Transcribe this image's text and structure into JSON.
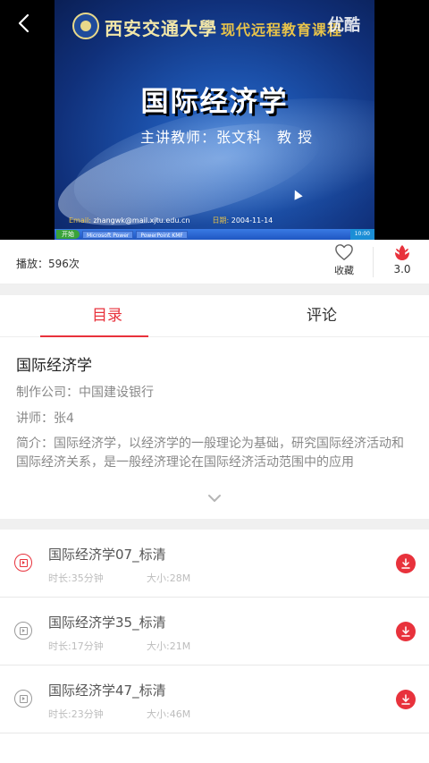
{
  "player": {
    "university": "西安交通大學",
    "program": "现代远程教育课程",
    "watermark": "优酷",
    "course_title": "国际经济学",
    "teacher_line": "主讲教师：张文科　教 授",
    "email_label": "Email:",
    "email": "zhangwk@mail.xjtu.edu.cn",
    "date_label": "日期:",
    "date": "2004-11-14",
    "taskbar": {
      "start": "开始",
      "items": [
        "Microsoft Power",
        "PowerPoint KMF"
      ],
      "clock": "10:00"
    }
  },
  "stats": {
    "plays": "播放：596次",
    "favorite_label": "收藏",
    "rating": "3.0"
  },
  "tabs": [
    {
      "label": "目录",
      "active": true
    },
    {
      "label": "评论",
      "active": false
    }
  ],
  "course": {
    "title": "国际经济学",
    "company_label": "制作公司：",
    "company": "中国建设银行",
    "lecturer_label": "讲师：",
    "lecturer": "张4",
    "intro_label": "简介：",
    "intro": "国际经济学，以经济学的一般理论为基础，研究国际经济活动和国际经济关系，是一般经济理论在国际经济活动范围中的应用"
  },
  "episodes": [
    {
      "title": "国际经济学07_标清",
      "duration": "时长:35分钟",
      "size": "大小:28M",
      "current": true
    },
    {
      "title": "国际经济学35_标清",
      "duration": "时长:17分钟",
      "size": "大小:21M",
      "current": false
    },
    {
      "title": "国际经济学47_标清",
      "duration": "时长:23分钟",
      "size": "大小:46M",
      "current": false
    }
  ],
  "colors": {
    "accent": "#e8323c",
    "divider": "#f0f0f0"
  },
  "icons": {
    "back": "back-arrow-icon",
    "favorite": "heart-outline-icon",
    "rating": "flower-icon",
    "expand": "chevron-down-icon",
    "play": "video-play-icon",
    "download": "download-icon"
  }
}
